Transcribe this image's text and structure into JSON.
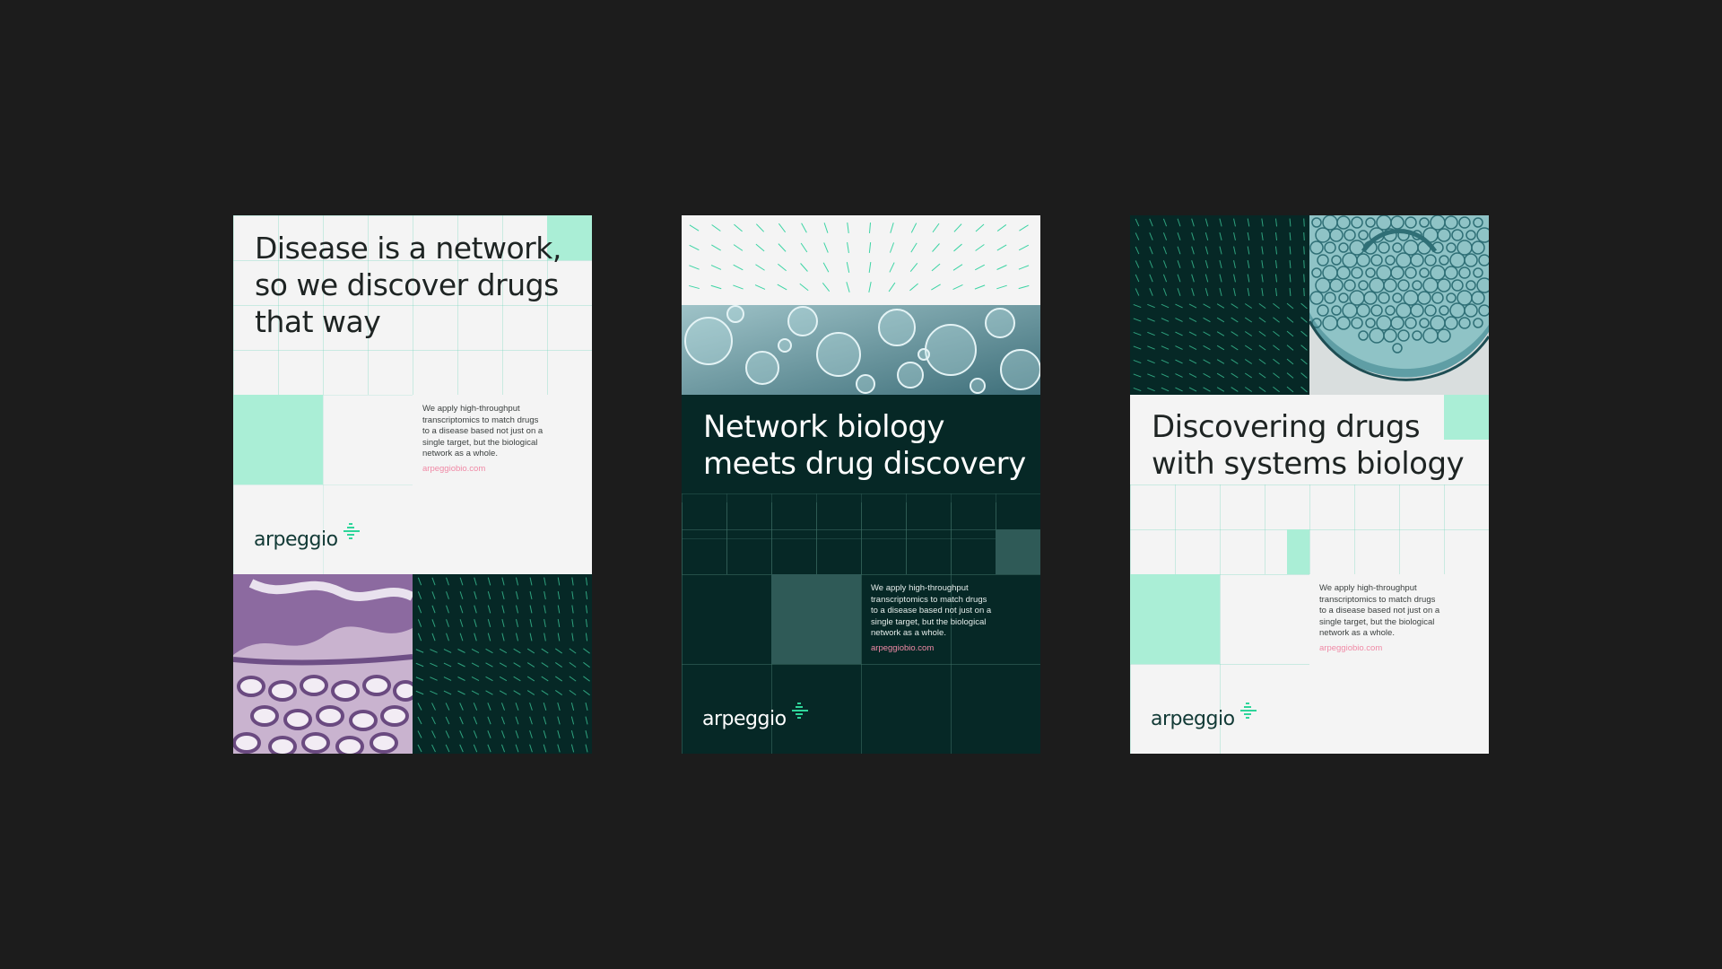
{
  "colors": {
    "background": "#1c1c1c",
    "paper": "#f4f4f4",
    "deep_green": "#062826",
    "mint": "#aaeed6",
    "teal_block": "#2f5a57",
    "accent_green": "#2fd59a",
    "link_pink": "#f08aa6"
  },
  "poster1": {
    "headline": [
      "Disease is a network,",
      "so we discover drugs",
      "that way"
    ],
    "body": [
      "We apply high-throughput",
      "transcriptomics to match drugs",
      "to a disease based not just on a",
      "single target, but the biological",
      "network as a whole."
    ],
    "url": "arpeggiobio.com",
    "logo": "arpeggio",
    "photo": "histology tissue micrograph"
  },
  "poster2": {
    "headline": [
      "Network biology",
      "meets drug discovery"
    ],
    "body": [
      "We apply high-throughput",
      "transcriptomics to match drugs",
      "to a disease based not just on a",
      "single target, but the biological",
      "network as a whole."
    ],
    "url": "arpeggiobio.com",
    "logo": "arpeggio",
    "photo": "bubbles in liquid"
  },
  "poster3": {
    "headline": [
      "Discovering drugs",
      "with systems biology"
    ],
    "body": [
      "We apply high-throughput",
      "transcriptomics to match drugs",
      "to a disease based not just on a",
      "single target, but the biological",
      "network as a whole."
    ],
    "url": "arpeggiobio.com",
    "logo": "arpeggio",
    "photo": "plant stem cross-section micrograph"
  }
}
